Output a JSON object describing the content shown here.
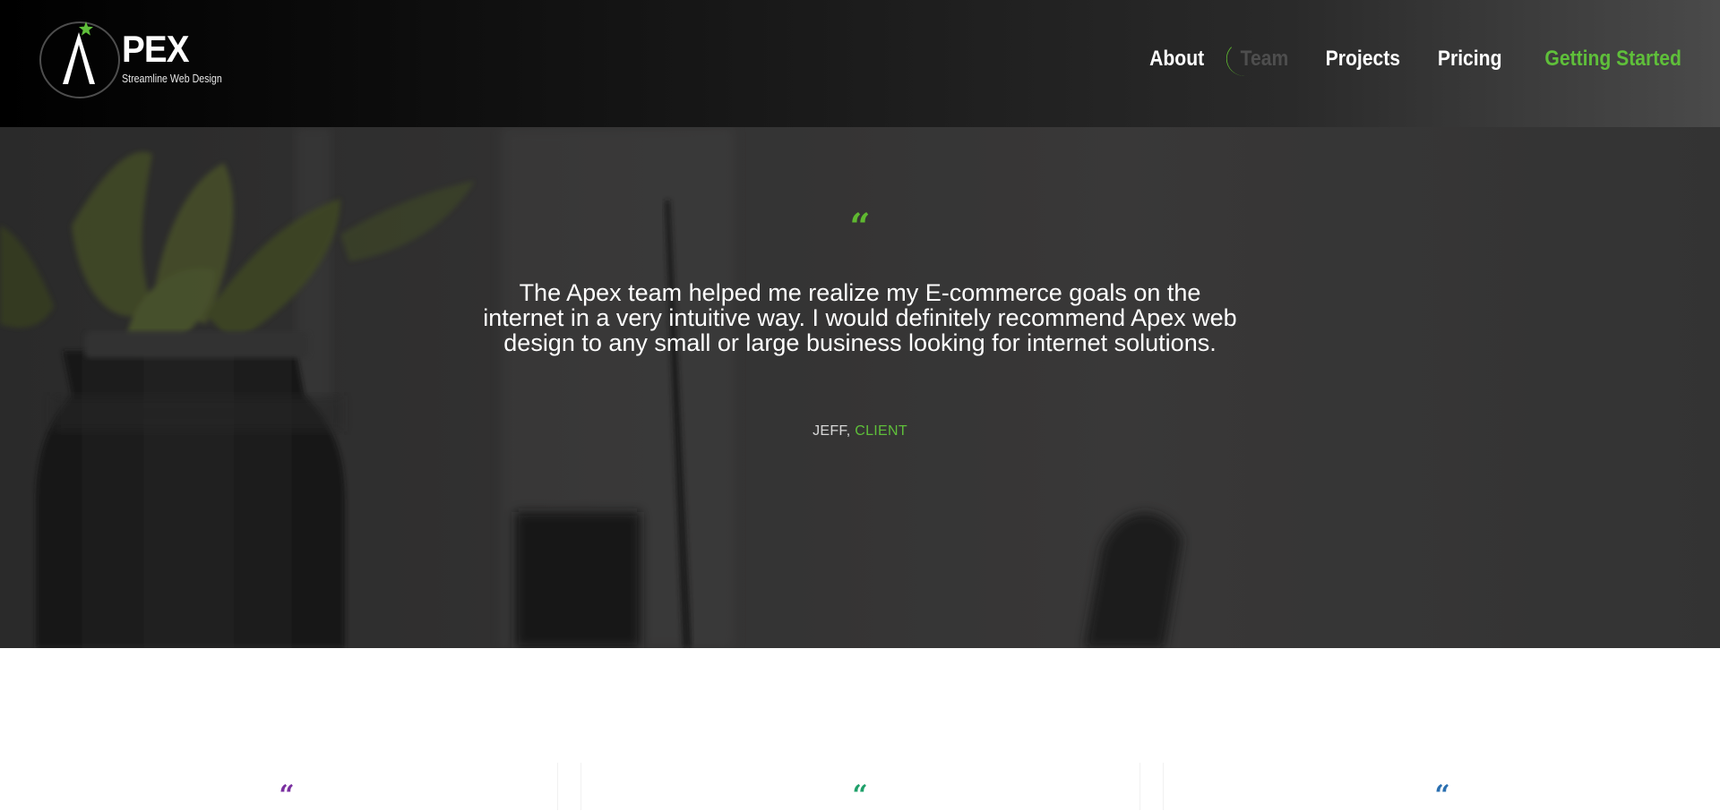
{
  "brand": {
    "logo_word": "PEX",
    "tagline": "Streamline Web Design"
  },
  "nav": {
    "items": [
      {
        "label": "About"
      },
      {
        "label": "Team"
      },
      {
        "label": "Projects"
      },
      {
        "label": "Pricing"
      },
      {
        "label": "Getting Started"
      }
    ],
    "active": "Team"
  },
  "hero": {
    "quote_mark": "“",
    "quote": "The Apex team helped me realize my E-commerce goals on the internet in a very intuitive way. I would definitely recommend Apex web design to any small or large business looking for internet solutions.",
    "author_name": "JEFF,",
    "author_role": "CLIENT"
  },
  "testimonials": [
    {
      "quote_mark": "“",
      "color": "#7a2fa0"
    },
    {
      "quote_mark": "“",
      "color": "#1fa06a"
    },
    {
      "quote_mark": "“",
      "color": "#2a6fb0"
    }
  ],
  "colors": {
    "accent_green": "#5fbf3a",
    "header_dark": "#000000",
    "hero_bg": "#3a3939"
  }
}
